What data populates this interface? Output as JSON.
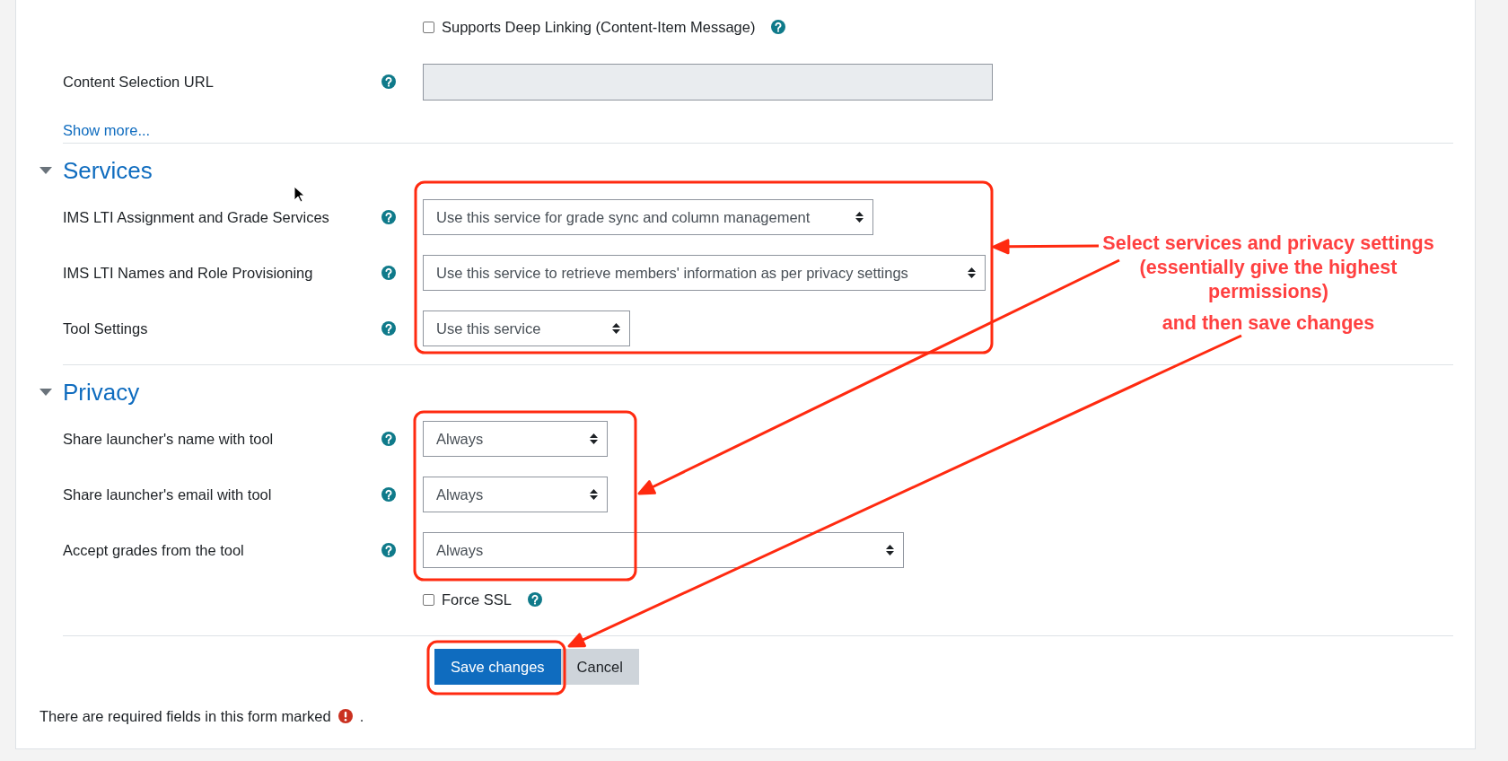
{
  "general": {
    "rows": [
      {
        "kind": "checkbox",
        "label": "Supports Deep Linking (Content-Item Message)",
        "checked": false
      },
      {
        "kind": "text",
        "label": "Content Selection URL",
        "disabled": true
      }
    ],
    "show_more": "Show more..."
  },
  "sections": [
    {
      "title": "Services",
      "expanded": true,
      "rows": [
        {
          "kind": "select",
          "label": "IMS LTI Assignment and Grade Services",
          "value": "Use this service for grade sync and column management"
        },
        {
          "kind": "select",
          "label": "IMS LTI Names and Role Provisioning",
          "value": "Use this service to retrieve members' information as per privacy settings"
        },
        {
          "kind": "select",
          "label": "Tool Settings",
          "value": "Use this service"
        }
      ]
    },
    {
      "title": "Privacy",
      "expanded": true,
      "rows": [
        {
          "kind": "select",
          "label": "Share launcher's name with tool",
          "value": "Always"
        },
        {
          "kind": "select",
          "label": "Share launcher's email with tool",
          "value": "Always"
        },
        {
          "kind": "select",
          "label": "Accept grades from the tool",
          "value": "Always"
        },
        {
          "kind": "checkbox",
          "label": "Force SSL",
          "checked": false
        }
      ]
    }
  ],
  "buttons": [
    {
      "label": "Save changes",
      "primary": true
    },
    {
      "label": "Cancel",
      "primary": false
    }
  ],
  "required_note": "There are required fields in this form marked",
  "required_note_end": ".",
  "annotations": [
    {
      "lines": [
        "Select services and privacy settings",
        "(essentially give the highest",
        "permissions)"
      ]
    },
    {
      "lines": [
        "and then save changes"
      ]
    }
  ]
}
